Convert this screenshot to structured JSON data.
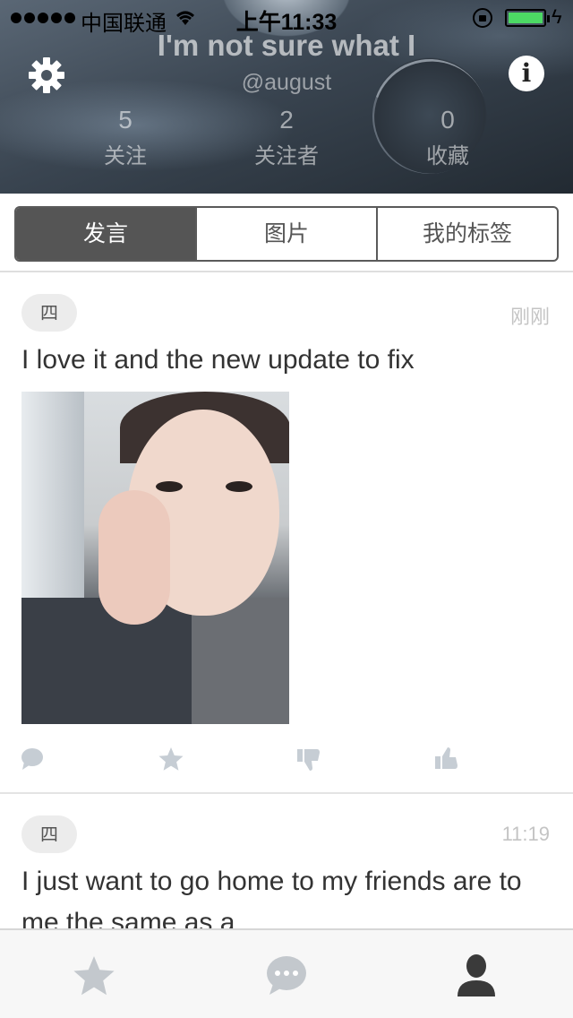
{
  "status_bar": {
    "carrier": "中国联通",
    "time": "上午11:33",
    "battery_level": 1.0,
    "battery_color": "#4cd964"
  },
  "profile": {
    "name": "I'm not sure what I",
    "handle": "@august",
    "stats": [
      {
        "count": "5",
        "label": "关注"
      },
      {
        "count": "2",
        "label": "关注者"
      },
      {
        "count": "0",
        "label": "收藏"
      }
    ],
    "icons": {
      "settings": "gear-icon",
      "info": "info-icon"
    },
    "info_glyph": "i"
  },
  "segments": {
    "items": [
      "发言",
      "图片",
      "我的标签"
    ],
    "active_index": 0,
    "active_color": "#555555"
  },
  "posts": [
    {
      "tag": "四",
      "time": "刚刚",
      "text": "I love it and the new update to fix",
      "has_photo": true,
      "actions": [
        "comment-icon",
        "star-icon",
        "thumbs-down-icon",
        "thumbs-up-icon"
      ]
    },
    {
      "tag": "四",
      "time": "11:19",
      "text": "I just want to go home to my friends are to me the same as a"
    }
  ],
  "tab_bar": {
    "items": [
      "star-icon",
      "chat-bubble-icon",
      "person-icon"
    ],
    "active_index": 2
  }
}
